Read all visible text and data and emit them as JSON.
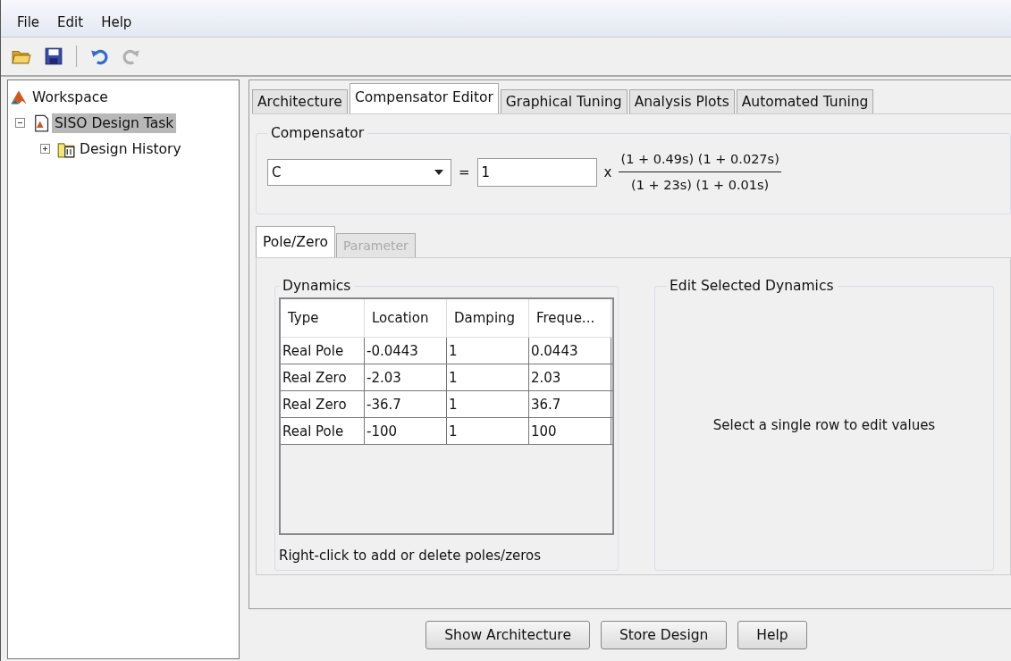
{
  "menu": [
    "File",
    "Edit",
    "Help"
  ],
  "toolbar": [
    {
      "kind": "open"
    },
    {
      "kind": "save"
    },
    {
      "kind": "sep"
    },
    {
      "kind": "undo",
      "disabled": false
    },
    {
      "kind": "redo",
      "disabled": true
    }
  ],
  "tree": [
    {
      "label": "Workspace",
      "kind": "root",
      "selected": false,
      "children": [
        {
          "label": "SISO Design Task",
          "kind": "task",
          "selected": true,
          "expanded": true,
          "children": [
            {
              "label": "Design History",
              "kind": "history",
              "selected": false,
              "expanded": false
            }
          ]
        }
      ]
    }
  ],
  "tabs": [
    {
      "label": "Architecture",
      "selected": false
    },
    {
      "label": "Compensator Editor",
      "selected": true
    },
    {
      "label": "Graphical Tuning",
      "selected": false
    },
    {
      "label": "Analysis Plots",
      "selected": false
    },
    {
      "label": "Automated Tuning",
      "selected": false
    }
  ],
  "compensator": {
    "title": "Compensator",
    "select": "C",
    "equals": "=",
    "gain": "1",
    "times": "x",
    "numerator": "(1 + 0.49s) (1 + 0.027s)",
    "denominator": "(1 + 23s) (1 + 0.01s)"
  },
  "subtabs": [
    {
      "label": "Pole/Zero",
      "selected": true,
      "disabled": false
    },
    {
      "label": "Parameter",
      "selected": false,
      "disabled": true
    }
  ],
  "dynamics": {
    "title": "Dynamics",
    "columns": [
      "Type",
      "Location",
      "Damping",
      "Freque..."
    ],
    "rows": [
      [
        "Real Pole",
        "-0.0443",
        "1",
        "0.0443"
      ],
      [
        "Real Zero",
        "-2.03",
        "1",
        "2.03"
      ],
      [
        "Real Zero",
        "-36.7",
        "1",
        "36.7"
      ],
      [
        "Real Pole",
        "-100",
        "1",
        "100"
      ]
    ],
    "hint": "Right-click to add or delete poles/zeros"
  },
  "edit": {
    "title": "Edit Selected Dynamics",
    "message": "Select a single row to edit values"
  },
  "buttons": [
    "Show Architecture",
    "Store Design",
    "Help"
  ]
}
